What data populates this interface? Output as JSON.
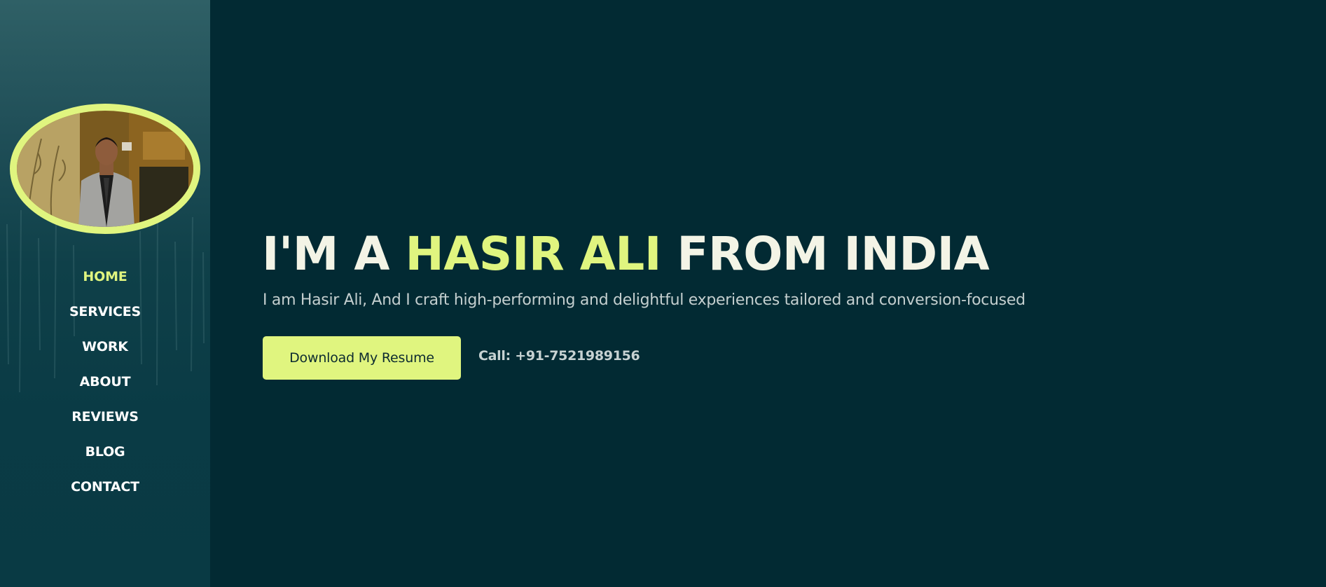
{
  "sidebar": {
    "profile_photo": "portrait-photo",
    "nav": [
      {
        "label": "HOME",
        "active": true
      },
      {
        "label": "SERVICES",
        "active": false
      },
      {
        "label": "WORK",
        "active": false
      },
      {
        "label": "ABOUT",
        "active": false
      },
      {
        "label": "REVIEWS",
        "active": false
      },
      {
        "label": "BLOG",
        "active": false
      },
      {
        "label": "CONTACT",
        "active": false
      }
    ]
  },
  "hero": {
    "headline_prefix": "I'M A ",
    "headline_accent": "HASIR ALI",
    "headline_suffix": " FROM INDIA",
    "subtitle": "I am Hasir Ali, And I craft high-performing and delightful experiences tailored and conversion-focused",
    "resume_button": "Download My Resume",
    "call_text": "Call: +91-7521989156"
  },
  "colors": {
    "accent": "#e0f57f",
    "background": "#022a33",
    "sidebar": "#0a3b45",
    "text": "#f3f4e6"
  }
}
